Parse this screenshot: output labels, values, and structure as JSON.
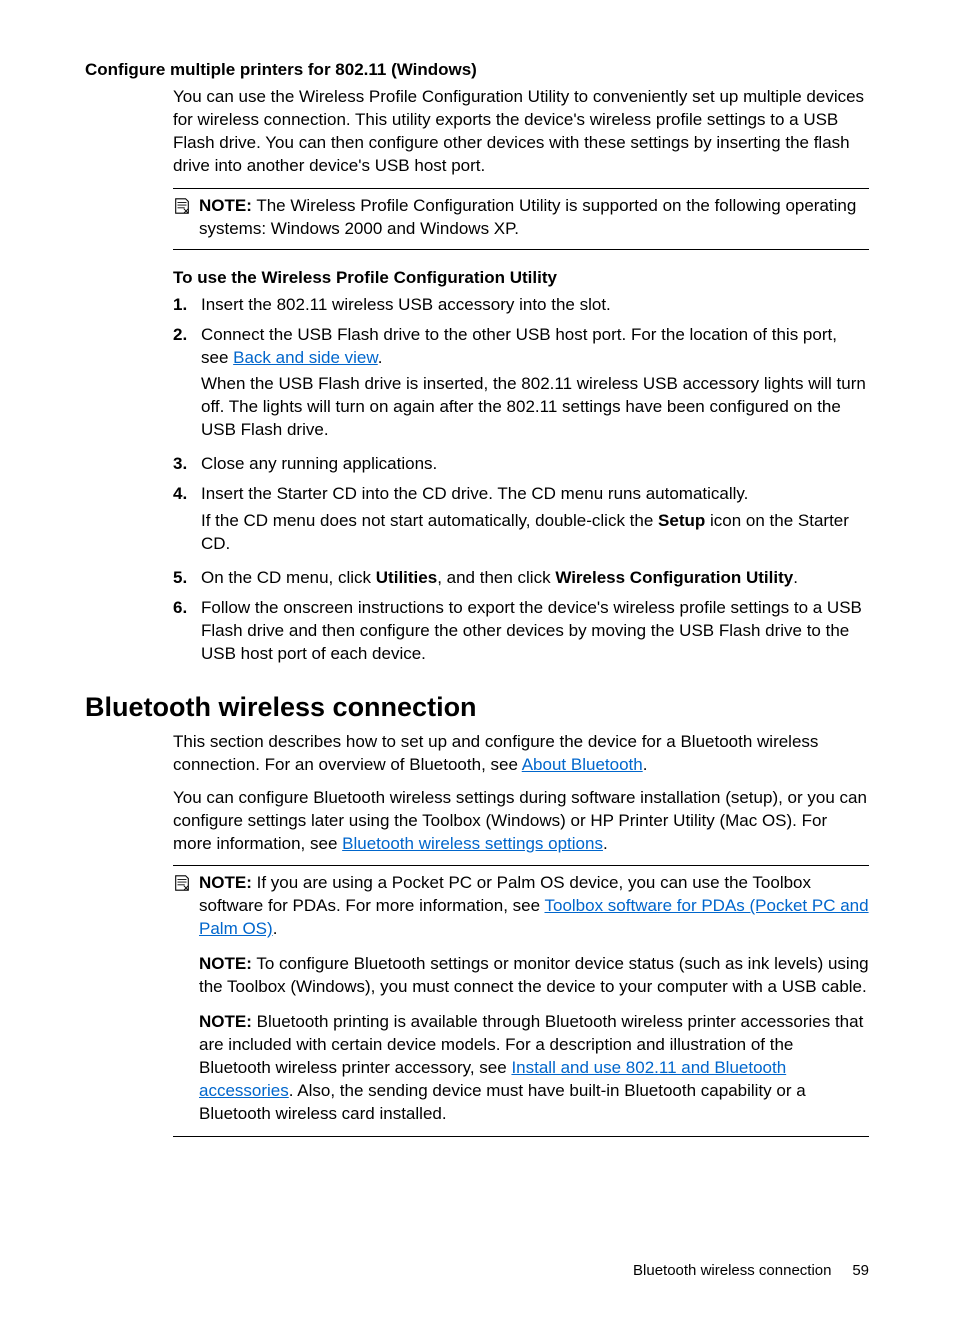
{
  "section1": {
    "title": "Configure multiple printers for 802.11 (Windows)",
    "intro": "You can use the Wireless Profile Configuration Utility to conveniently set up multiple devices for wireless connection. This utility exports the device's wireless profile settings to a USB Flash drive. You can then configure other devices with these settings by inserting the flash drive into another device's USB host port.",
    "note_label": "NOTE:",
    "note_text": "The Wireless Profile Configuration Utility is supported on the following operating systems: Windows 2000 and Windows XP.",
    "sub_heading": "To use the Wireless Profile Configuration Utility",
    "steps": {
      "s1": {
        "num": "1.",
        "text": "Insert the 802.11 wireless USB accessory into the slot."
      },
      "s2": {
        "num": "2.",
        "p1a": "Connect the USB Flash drive to the other USB host port. For the location of this port, see ",
        "link": "Back and side view",
        "p1b": ".",
        "p2": "When the USB Flash drive is inserted, the 802.11 wireless USB accessory lights will turn off. The lights will turn on again after the 802.11 settings have been configured on the USB Flash drive."
      },
      "s3": {
        "num": "3.",
        "text": "Close any running applications."
      },
      "s4": {
        "num": "4.",
        "p1": "Insert the Starter CD into the CD drive. The CD menu runs automatically.",
        "p2a": "If the CD menu does not start automatically, double-click the ",
        "bold": "Setup",
        "p2b": " icon on the Starter CD."
      },
      "s5": {
        "num": "5.",
        "a": "On the CD menu, click ",
        "b1": "Utilities",
        "b": ", and then click ",
        "b2": "Wireless Configuration Utility",
        "c": "."
      },
      "s6": {
        "num": "6.",
        "text": "Follow the onscreen instructions to export the device's wireless profile settings to a USB Flash drive and then configure the other devices by moving the USB Flash drive to the USB host port of each device."
      }
    }
  },
  "section2": {
    "title": "Bluetooth wireless connection",
    "p1a": "This section describes how to set up and configure the device for a Bluetooth wireless connection. For an overview of Bluetooth, see ",
    "p1_link": "About Bluetooth",
    "p1b": ".",
    "p2a": "You can configure Bluetooth wireless settings during software installation (setup), or you can configure settings later using the Toolbox (Windows) or HP Printer Utility (Mac OS). For more information, see ",
    "p2_link": "Bluetooth wireless settings options",
    "p2b": ".",
    "notes": {
      "label": "NOTE:",
      "n1a": "If you are using a Pocket PC or Palm OS device, you can use the Toolbox software for PDAs. For more information, see ",
      "n1_link": "Toolbox software for PDAs (Pocket PC and Palm OS)",
      "n1b": ".",
      "n2": "To configure Bluetooth settings or monitor device status (such as ink levels) using the Toolbox (Windows), you must connect the device to your computer with a USB cable.",
      "n3a": "Bluetooth printing is available through Bluetooth wireless printer accessories that are included with certain device models. For a description and illustration of the Bluetooth wireless printer accessory, see ",
      "n3_link": "Install and use 802.11 and Bluetooth accessories",
      "n3b": ". Also, the sending device must have built-in Bluetooth capability or a Bluetooth wireless card installed."
    }
  },
  "footer": {
    "text": "Bluetooth wireless connection",
    "page": "59"
  }
}
